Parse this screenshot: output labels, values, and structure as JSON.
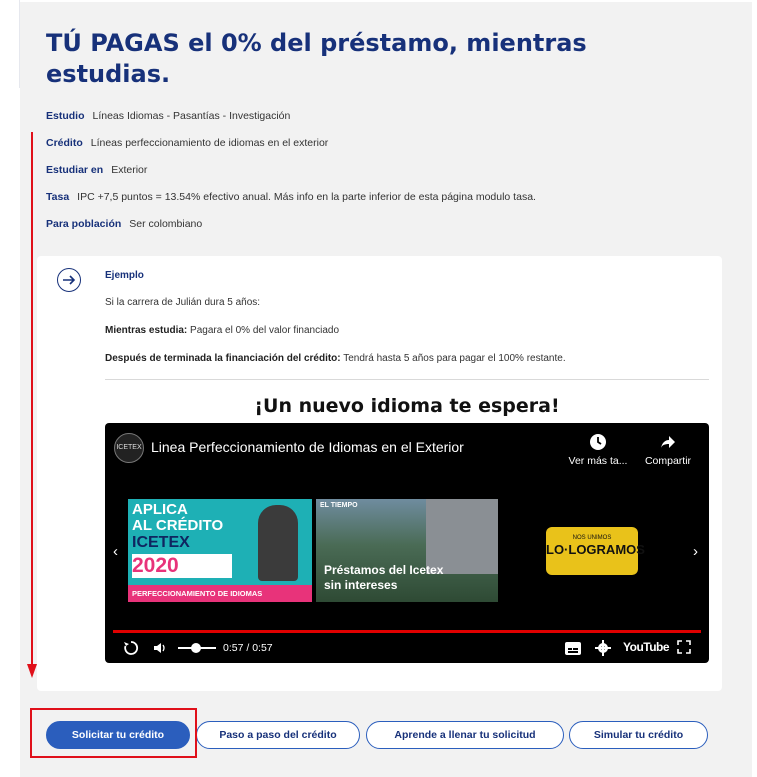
{
  "page": {
    "title": "TÚ PAGAS el 0% del préstamo, mientras estudias."
  },
  "info": [
    {
      "label": "Estudio",
      "value": "Líneas Idiomas - Pasantías - Investigación"
    },
    {
      "label": "Crédito",
      "value": "Líneas perfeccionamiento de idiomas en el exterior"
    },
    {
      "label": "Estudiar en",
      "value": "Exterior"
    },
    {
      "label": "Tasa",
      "value": "IPC +7,5 puntos = 13.54% efectivo anual. Más info en la parte inferior de esta página modulo tasa."
    },
    {
      "label": "Para población",
      "value": "Ser colombiano"
    }
  ],
  "example": {
    "title": "Ejemplo",
    "intro": "Si la carrera de Julián dura 5 años:",
    "line1_label": "Mientras estudia:",
    "line1_text": "Pagara el 0% del valor financiado",
    "line2_label": "Después de terminada la financiación del crédito:",
    "line2_text": "Tendrá hasta 5 años para pagar el 100% restante."
  },
  "video_heading": "¡Un nuevo idioma te espera!",
  "video": {
    "channel_logo": "ICETEX",
    "title": "Linea Perfeccionamiento de Idiomas en el Exterior",
    "watch_later": "Ver más ta...",
    "share": "Compartir",
    "thumb1_line1": "APLICA",
    "thumb1_line2": "AL CRÉDITO",
    "thumb1_line3": "ICETEX",
    "thumb1_year": "2020",
    "thumb1_footer": "PERFECCIONAMIENTO DE IDIOMAS",
    "thumb2_tag": "EL TIEMPO",
    "thumb2_text": "Préstamos del Icetex sin intereses",
    "plate_top": "NOS UNIMOS",
    "plate_main": "LO·LOGRAMOS",
    "time": "0:57 / 0:57",
    "brand": "YouTube",
    "progress": 1.0
  },
  "buttons": {
    "apply": "Solicitar tu crédito",
    "steps": "Paso a paso del crédito",
    "learn": "Aprende a llenar tu solicitud",
    "simulate": "Simular tu crédito"
  },
  "colors": {
    "brand_blue": "#17317a",
    "button_blue": "#2b5ebd",
    "annotation_red": "#e0101a"
  }
}
